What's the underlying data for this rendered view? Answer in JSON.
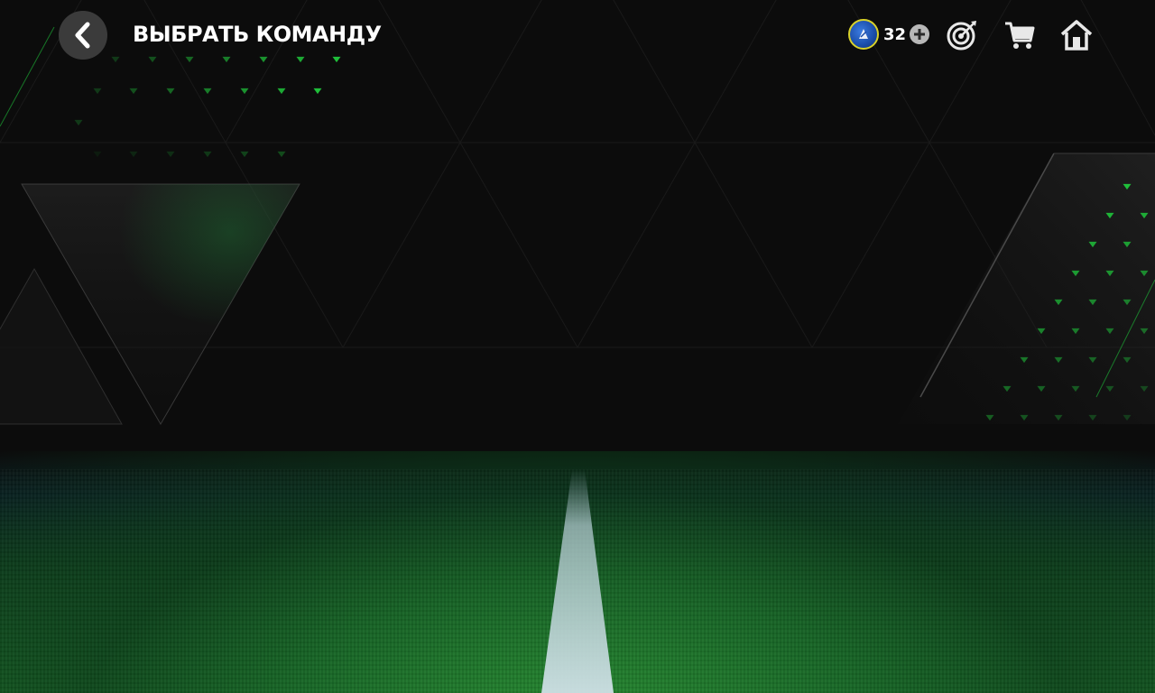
{
  "header": {
    "title": "ВЫБРАТЬ КОМАНДУ",
    "back_icon": "back-chevron-icon"
  },
  "currency": {
    "icon": "coin-icon",
    "value": "32",
    "add_icon": "plus-icon"
  },
  "nav": {
    "objectives_icon": "target-icon",
    "store_icon": "cart-icon",
    "home_icon": "home-icon"
  },
  "colors": {
    "accent_green": "#1fbf3a",
    "background": "#0c0c0c",
    "pitch_green": "#1f7a32",
    "button_gray": "#3b3b3b"
  }
}
